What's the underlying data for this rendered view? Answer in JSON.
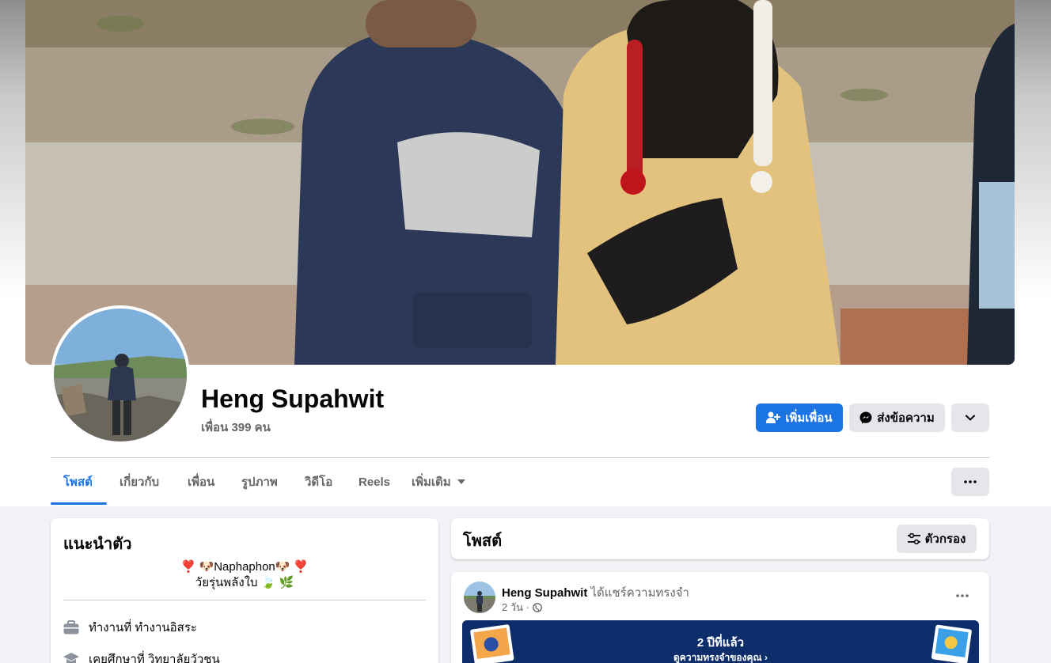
{
  "profile": {
    "name": "Heng Supahwit",
    "friends_count": "เพื่อน 399 คน"
  },
  "actions": {
    "add_friend": "เพิ่มเพื่อน",
    "message": "ส่งข้อความ"
  },
  "tabs": [
    {
      "label": "โพสต์",
      "active": true
    },
    {
      "label": "เกี่ยวกับ"
    },
    {
      "label": "เพื่อน"
    },
    {
      "label": "รูปภาพ"
    },
    {
      "label": "วิดีโอ"
    },
    {
      "label": "Reels"
    },
    {
      "label": "เพิ่มเติม"
    }
  ],
  "intro": {
    "title": "แนะนำตัว",
    "bio_line1": "❣️ 🐶Naphaphon🐶 ❣️",
    "bio_line2": "วัยรุ่นพลังใบ 🍃 🌿",
    "work": "ทำงานที่ ทำงานอิสระ",
    "education": "เคยศึกษาที่ วิทยาลัยวัวชน"
  },
  "posts": {
    "title": "โพสต์",
    "filter_label": "ตัวกรอง"
  },
  "post": {
    "author": "Heng Supahwit",
    "action": "ได้แชร์ความทรงจำ",
    "time": "2 วัน ·",
    "memory_title": "2 ปีที่แล้ว",
    "memory_sub": "ดูความทรงจำของคุณ ›"
  },
  "colors": {
    "accent": "#1b74e4",
    "memory_bg": "#0d2d6b"
  }
}
